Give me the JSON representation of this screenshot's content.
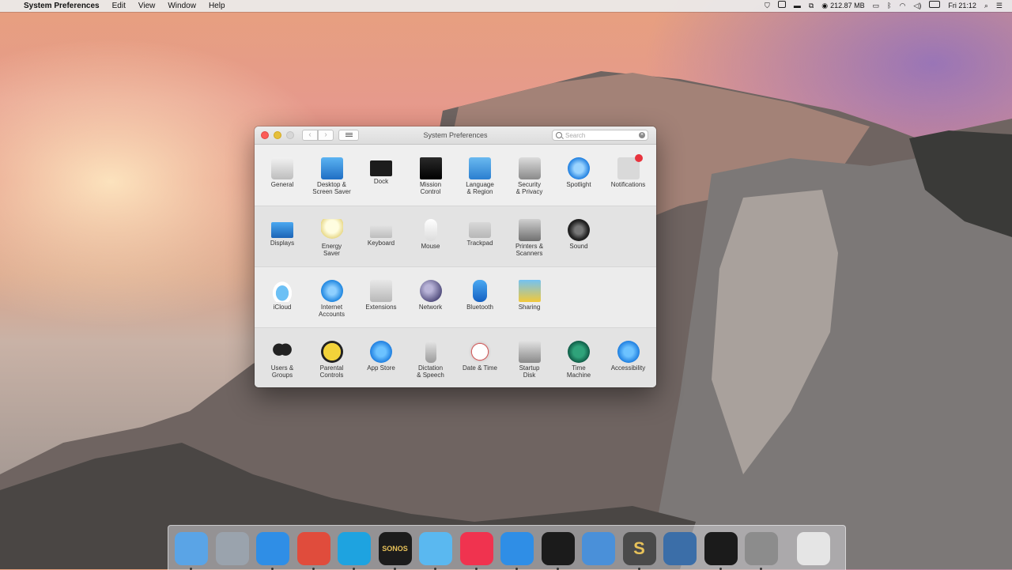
{
  "menubar": {
    "apple": "",
    "app_name": "System Preferences",
    "menus": [
      "Edit",
      "View",
      "Window",
      "Help"
    ],
    "status": {
      "memory": "212.87 MB",
      "clock": "Fri 21:12"
    }
  },
  "window": {
    "title": "System Preferences",
    "back": "‹",
    "forward": "›",
    "search_placeholder": "Search",
    "search_clear": "×"
  },
  "sections": [
    {
      "panes": [
        {
          "label": "General",
          "icon": "general-icon"
        },
        {
          "label": "Desktop &\nScreen Saver",
          "icon": "desktop-icon"
        },
        {
          "label": "Dock",
          "icon": "dock-icon"
        },
        {
          "label": "Mission\nControl",
          "icon": "mission-control-icon"
        },
        {
          "label": "Language\n& Region",
          "icon": "language-icon"
        },
        {
          "label": "Security\n& Privacy",
          "icon": "security-icon"
        },
        {
          "label": "Spotlight",
          "icon": "spotlight-icon"
        },
        {
          "label": "Notifications",
          "icon": "notifications-icon"
        }
      ]
    },
    {
      "panes": [
        {
          "label": "Displays",
          "icon": "displays-icon"
        },
        {
          "label": "Energy\nSaver",
          "icon": "energy-icon"
        },
        {
          "label": "Keyboard",
          "icon": "keyboard-icon"
        },
        {
          "label": "Mouse",
          "icon": "mouse-icon"
        },
        {
          "label": "Trackpad",
          "icon": "trackpad-icon"
        },
        {
          "label": "Printers &\nScanners",
          "icon": "printer-icon"
        },
        {
          "label": "Sound",
          "icon": "sound-icon"
        }
      ]
    },
    {
      "panes": [
        {
          "label": "iCloud",
          "icon": "icloud-icon"
        },
        {
          "label": "Internet\nAccounts",
          "icon": "internet-accounts-icon"
        },
        {
          "label": "Extensions",
          "icon": "extensions-icon"
        },
        {
          "label": "Network",
          "icon": "network-icon"
        },
        {
          "label": "Bluetooth",
          "icon": "bluetooth-icon"
        },
        {
          "label": "Sharing",
          "icon": "sharing-icon"
        }
      ]
    },
    {
      "panes": [
        {
          "label": "Users &\nGroups",
          "icon": "users-icon"
        },
        {
          "label": "Parental\nControls",
          "icon": "parental-icon"
        },
        {
          "label": "App Store",
          "icon": "appstore-icon"
        },
        {
          "label": "Dictation\n& Speech",
          "icon": "dictation-icon"
        },
        {
          "label": "Date & Time",
          "icon": "datetime-icon"
        },
        {
          "label": "Startup\nDisk",
          "icon": "startup-icon"
        },
        {
          "label": "Time\nMachine",
          "icon": "timemachine-icon"
        },
        {
          "label": "Accessibility",
          "icon": "accessibility-icon"
        }
      ]
    }
  ],
  "dock": {
    "items": [
      {
        "name": "finder-icon",
        "color": "#5aa4e6"
      },
      {
        "name": "launchpad-icon",
        "color": "#9aa3ad"
      },
      {
        "name": "safari-icon",
        "color": "#2f8ee6"
      },
      {
        "name": "chrome-icon",
        "color": "#e04c3c"
      },
      {
        "name": "skype-icon",
        "color": "#1ea3e0"
      },
      {
        "name": "sonos-icon",
        "color": "#1c1c1c",
        "text": "SONOS"
      },
      {
        "name": "messages-icon",
        "color": "#5ab8f0"
      },
      {
        "name": "itunes-icon",
        "color": "#f0334f"
      },
      {
        "name": "appstore-dock-icon",
        "color": "#2f8ee6"
      },
      {
        "name": "terminal-icon",
        "color": "#1b1b1b"
      },
      {
        "name": "xcode-icon",
        "color": "#4a90d9"
      },
      {
        "name": "sublime-icon",
        "color": "#4a4a4a",
        "text": "S"
      },
      {
        "name": "photo-app-icon",
        "color": "#3b6ea8"
      },
      {
        "name": "console-icon",
        "color": "#1b1b1b"
      },
      {
        "name": "system-preferences-dock-icon",
        "color": "#8c8c8c"
      },
      {
        "name": "trash-icon",
        "color": "#e5e5e5"
      }
    ]
  }
}
